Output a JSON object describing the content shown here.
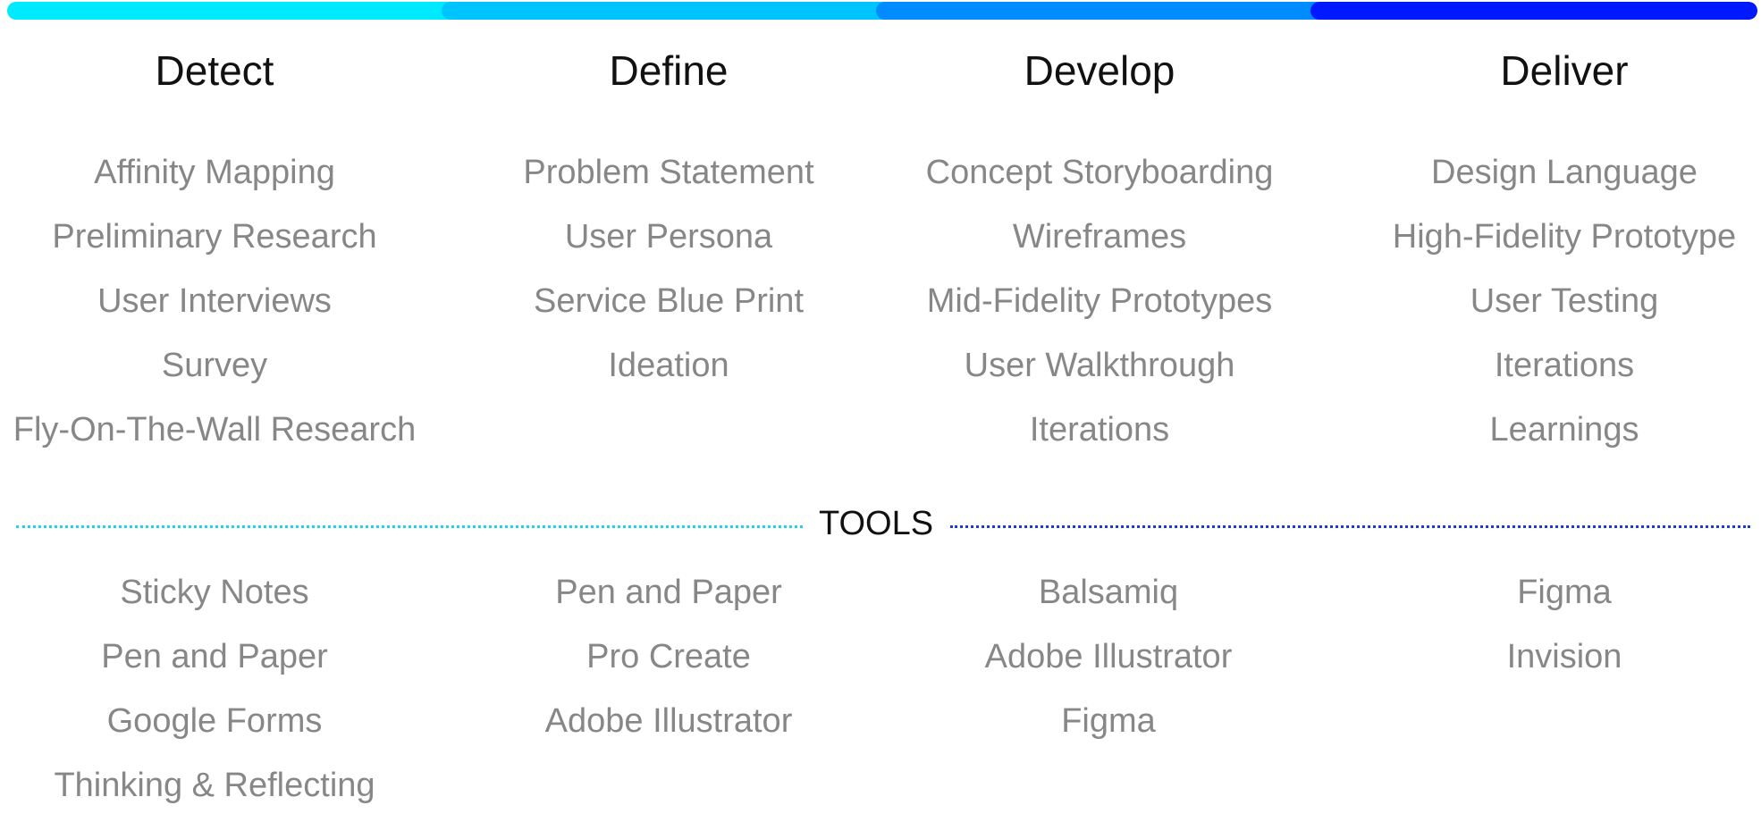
{
  "progress_segments": [
    {
      "phase": "Detect",
      "color": "#00eaff"
    },
    {
      "phase": "Define",
      "color": "#00c4ff"
    },
    {
      "phase": "Develop",
      "color": "#008cff"
    },
    {
      "phase": "Deliver",
      "color": "#0019ff"
    }
  ],
  "phases": [
    {
      "title": "Detect",
      "methods": [
        "Affinity Mapping",
        "Preliminary Research",
        "User Interviews",
        "Survey",
        "Fly-On-The-Wall Research"
      ],
      "tools": [
        "Sticky Notes",
        "Pen and Paper",
        "Google Forms",
        "Thinking & Reflecting"
      ]
    },
    {
      "title": "Define",
      "methods": [
        "Problem Statement",
        "User Persona",
        "Service Blue Print",
        "Ideation"
      ],
      "tools": [
        "Pen and Paper",
        "Pro Create",
        "Adobe Illustrator"
      ]
    },
    {
      "title": "Develop",
      "methods": [
        "Concept Storyboarding",
        "Wireframes",
        "Mid-Fidelity Prototypes",
        "User Walkthrough",
        "Iterations"
      ],
      "tools": [
        "Balsamiq",
        "Adobe Illustrator",
        "Figma"
      ]
    },
    {
      "title": "Deliver",
      "methods": [
        "Design Language",
        "High-Fidelity Prototype",
        "User Testing",
        "Iterations",
        "Learnings"
      ],
      "tools": [
        "Figma",
        "Invision"
      ]
    }
  ],
  "tools_section": {
    "label": "TOOLS",
    "left_color": "#1fd0f0",
    "right_color": "#1a3ae0"
  },
  "colors": {
    "heading": "#111111",
    "item": "#878787"
  }
}
